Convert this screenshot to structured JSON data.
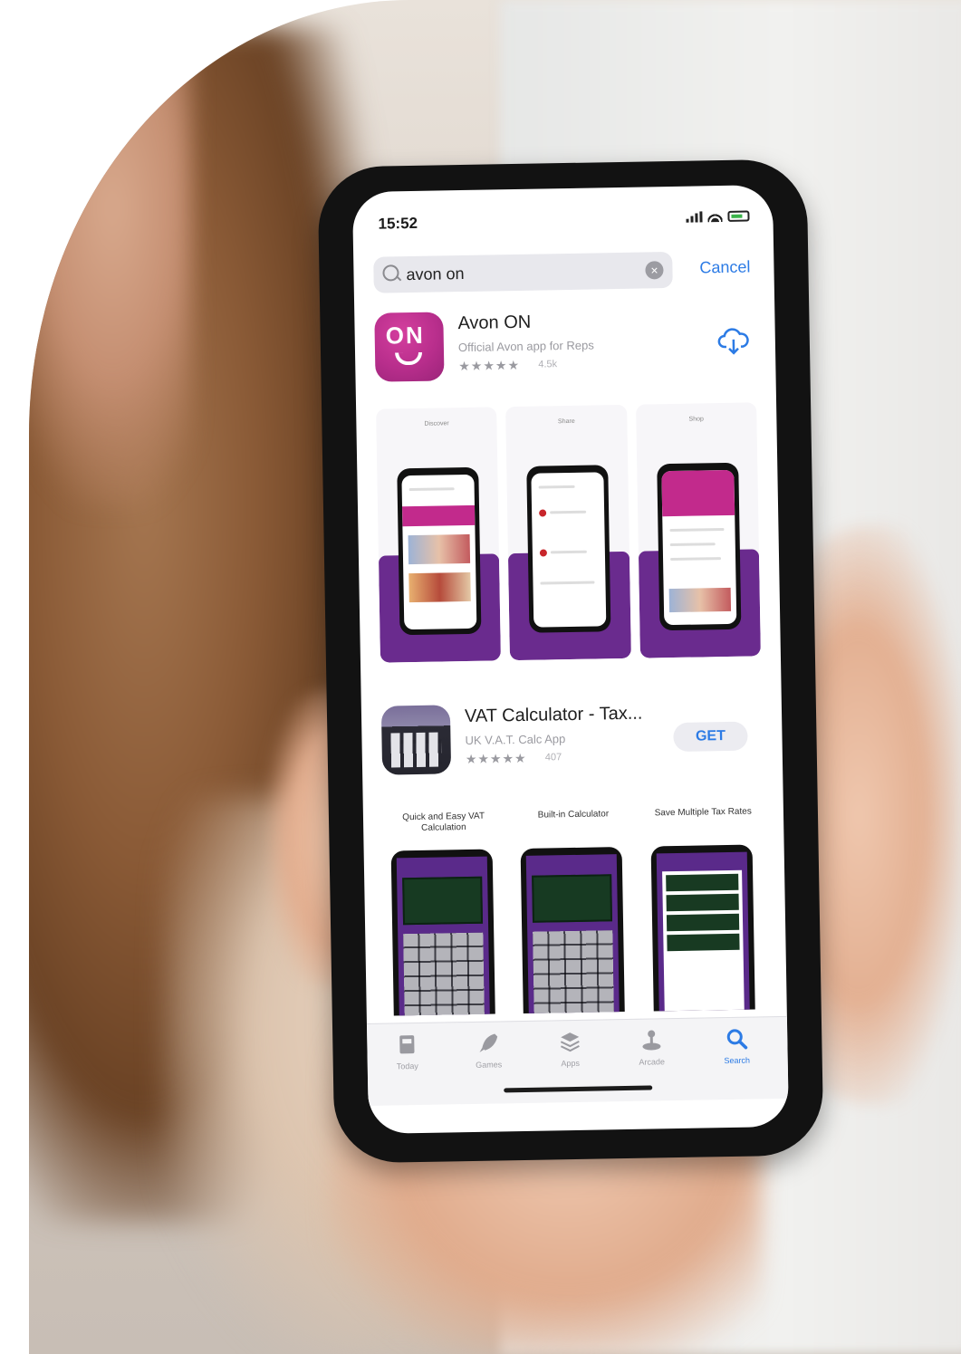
{
  "status_bar": {
    "time": "15:52"
  },
  "search": {
    "query": "avon on",
    "cancel_label": "Cancel"
  },
  "results": [
    {
      "name": "Avon ON",
      "subtitle": "Official Avon app for Reps",
      "stars": "★★★★★",
      "rating_count": "4.5k",
      "icon_text": "ON",
      "action": "download",
      "screenshots": [
        "Discover",
        "Share",
        "Shop"
      ]
    },
    {
      "name": "VAT Calculator - Tax...",
      "subtitle": "UK V.A.T. Calc App",
      "stars": "★★★★★",
      "rating_count": "407",
      "action_label": "GET",
      "screenshots": [
        "Quick and Easy VAT Calculation",
        "Built-in Calculator",
        "Save Multiple Tax Rates"
      ]
    }
  ],
  "tabs": [
    {
      "label": "Today",
      "icon": "today-icon"
    },
    {
      "label": "Games",
      "icon": "games-icon"
    },
    {
      "label": "Apps",
      "icon": "apps-icon"
    },
    {
      "label": "Arcade",
      "icon": "arcade-icon"
    },
    {
      "label": "Search",
      "icon": "search-icon",
      "active": true
    }
  ],
  "colors": {
    "accent": "#2c7be5",
    "avon_brand": "#b82e8c",
    "purple": "#6a2b8e"
  }
}
